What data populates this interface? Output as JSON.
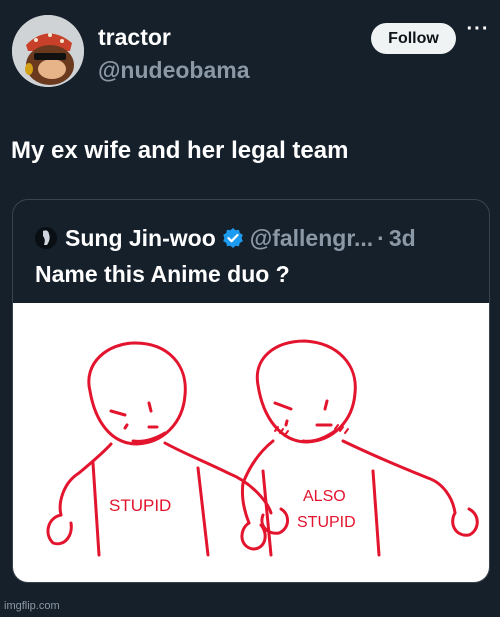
{
  "tweet": {
    "display_name": "tractor",
    "handle": "@nudeobama",
    "follow_label": "Follow",
    "more_label": "···",
    "text": "My ex wife and her legal team"
  },
  "quoted_tweet": {
    "display_name": "Sung Jin-woo",
    "handle": "@fallengr...",
    "separator": "·",
    "time": "3d",
    "text": "Name this Anime duo ?",
    "image": {
      "left_shirt_text": "STUPID",
      "right_shirt_text_line1": "ALSO",
      "right_shirt_text_line2": "STUPID",
      "stroke_color": "#e3142d"
    }
  },
  "verified_color": "#1d9bf0",
  "watermark": "imgflip.com"
}
